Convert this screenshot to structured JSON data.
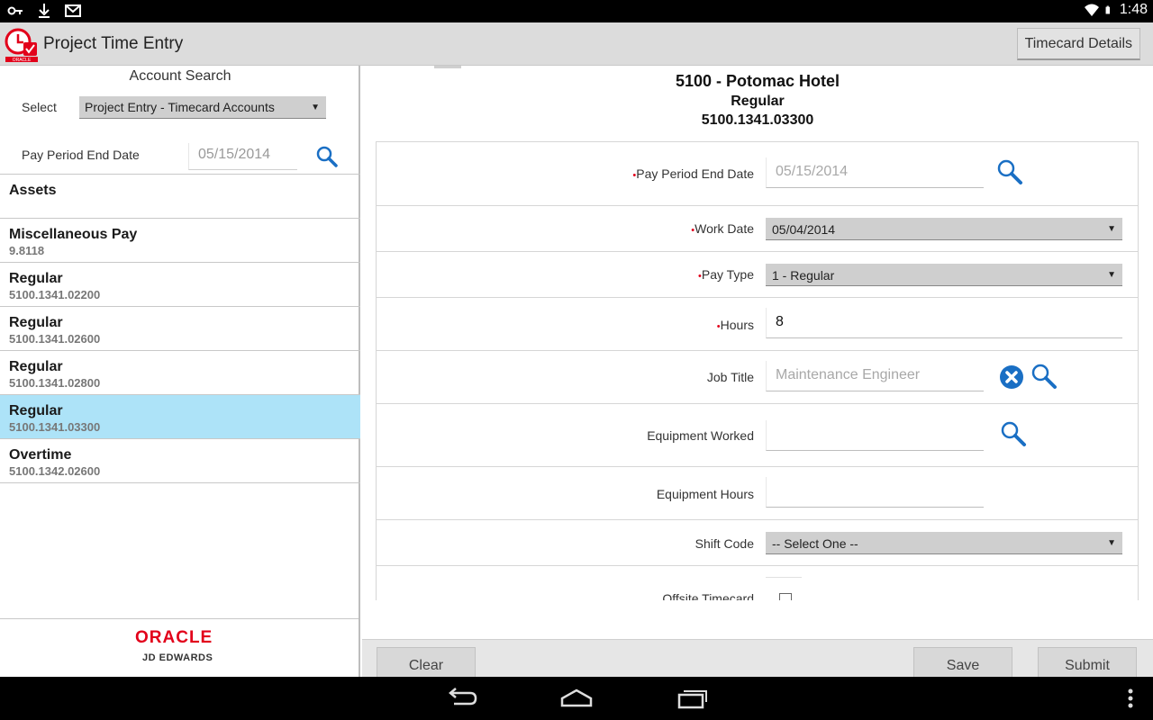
{
  "status_bar": {
    "time": "1:48",
    "icons": [
      "key-icon",
      "download-icon",
      "gmail-icon",
      "wifi-icon",
      "battery-icon"
    ]
  },
  "action_bar": {
    "title": "Project Time Entry",
    "timecard_details_label": "Timecard Details",
    "logo_text": "ORACLE"
  },
  "left_pane": {
    "title": "Account Search",
    "select_label": "Select",
    "select_value": "Project Entry - Timecard Accounts",
    "pay_period_label": "Pay Period End Date",
    "pay_period_value": "05/15/2014",
    "accounts": [
      {
        "title": "Assets",
        "subtitle": ""
      },
      {
        "title": "Miscellaneous Pay",
        "subtitle": "9.8118"
      },
      {
        "title": "Regular",
        "subtitle": "5100.1341.02200"
      },
      {
        "title": "Regular",
        "subtitle": "5100.1341.02600"
      },
      {
        "title": "Regular",
        "subtitle": "5100.1341.02800"
      },
      {
        "title": "Regular",
        "subtitle": "5100.1341.03300",
        "selected": true
      },
      {
        "title": "Overtime",
        "subtitle": "5100.1342.02600"
      }
    ],
    "footer": {
      "oracle": "ORACLE",
      "jde": "JD EDWARDS"
    }
  },
  "detail": {
    "header_line1": "5100 - Potomac Hotel",
    "header_line2": "Regular",
    "header_line3": "5100.1341.03300",
    "fields": {
      "pay_period_end_date": {
        "label": "Pay Period End Date",
        "placeholder": "05/15/2014",
        "required": true
      },
      "work_date": {
        "label": "Work Date",
        "value": "05/04/2014",
        "required": true
      },
      "pay_type": {
        "label": "Pay Type",
        "value": "1 - Regular",
        "required": true
      },
      "hours": {
        "label": "Hours",
        "value": "8",
        "required": true
      },
      "job_title": {
        "label": "Job Title",
        "placeholder": "Maintenance Engineer"
      },
      "equipment_worked": {
        "label": "Equipment Worked",
        "value": ""
      },
      "equipment_hours": {
        "label": "Equipment Hours",
        "value": ""
      },
      "shift_code": {
        "label": "Shift Code",
        "value": "-- Select One --"
      },
      "offsite_timecard": {
        "label": "Offsite Timecard",
        "checked": false
      }
    },
    "required_marker": "•"
  },
  "buttons": {
    "clear": "Clear",
    "save": "Save",
    "submit": "Submit"
  },
  "colors": {
    "accent_blue": "#1a6fc4",
    "selected_row": "#ade3f8",
    "required_red": "#e2001a",
    "oracle_red": "#e2001a"
  }
}
